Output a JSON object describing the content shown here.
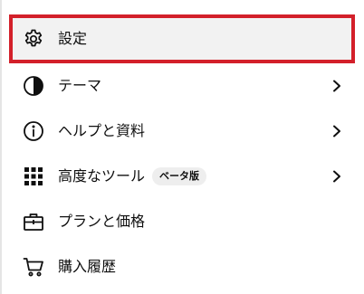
{
  "menu": {
    "items": [
      {
        "label": "設定",
        "icon": "gear-icon",
        "selected": true
      },
      {
        "label": "テーマ",
        "icon": "theme-icon",
        "has_submenu": true
      },
      {
        "label": "ヘルプと資料",
        "icon": "info-icon",
        "has_submenu": true
      },
      {
        "label": "高度なツール",
        "icon": "grid-icon",
        "badge": "ベータ版",
        "has_submenu": true
      },
      {
        "label": "プランと価格",
        "icon": "briefcase-icon"
      },
      {
        "label": "購入履歴",
        "icon": "cart-icon"
      }
    ]
  },
  "colors": {
    "highlight_border": "#d3202a",
    "selected_bg": "#f2f2f2",
    "badge_bg": "#eeeeee"
  }
}
